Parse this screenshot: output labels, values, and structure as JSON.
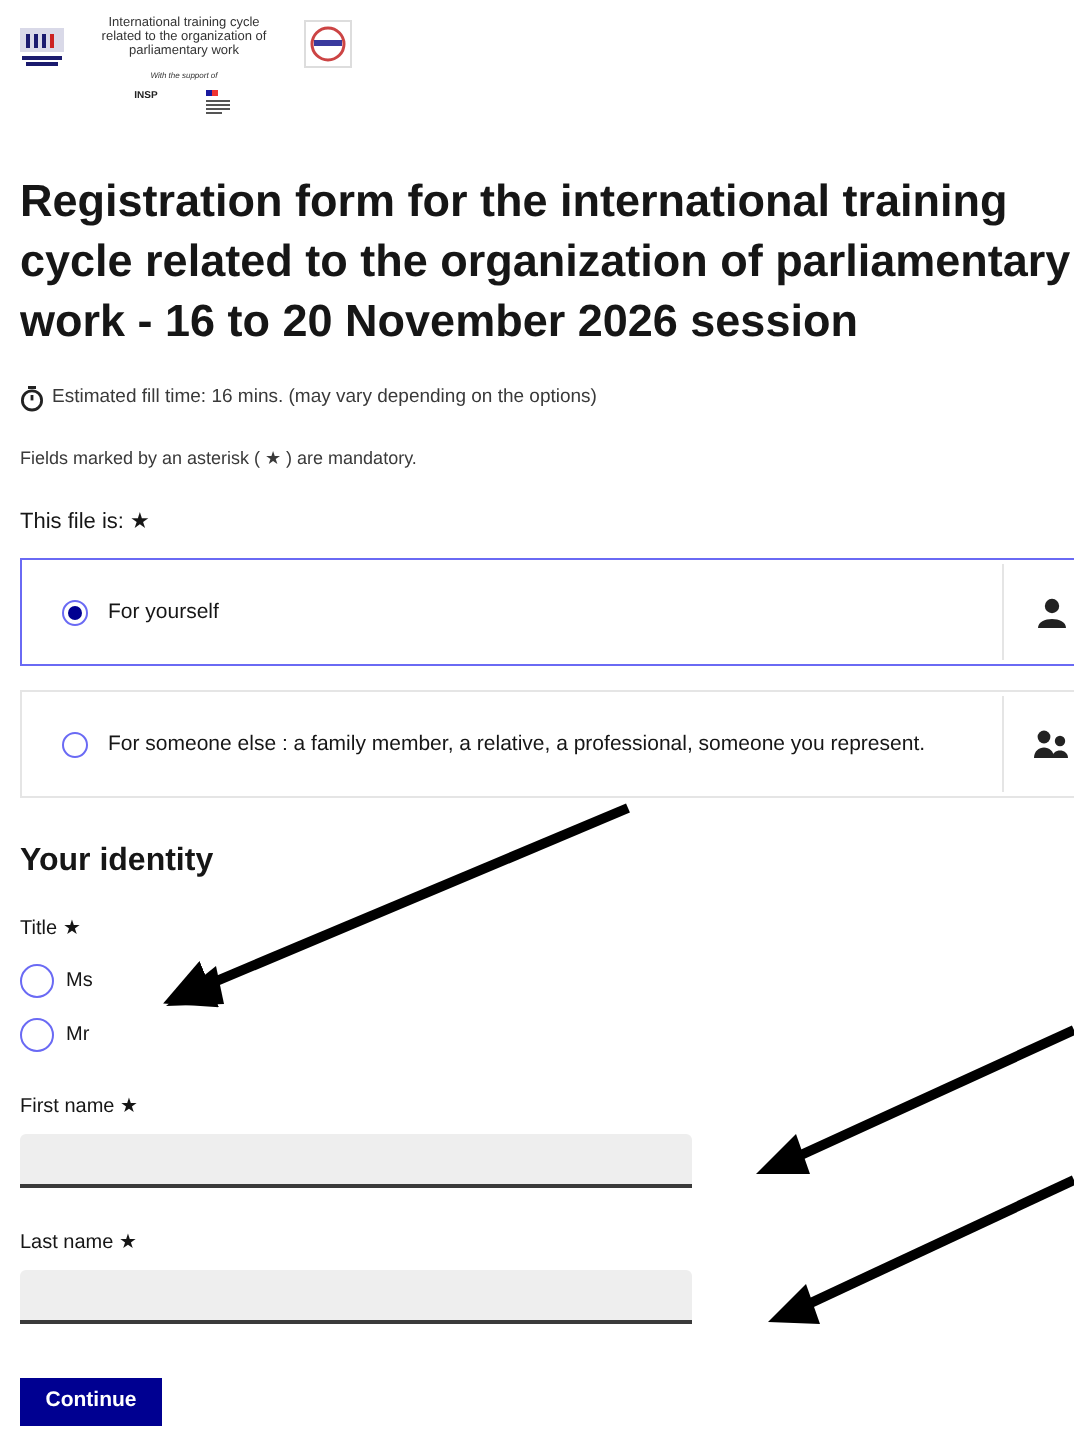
{
  "header": {
    "program_title": "International training cycle related to the organization of parliamentary work",
    "support_text": "With the support of",
    "partner_logo_text": "INSP"
  },
  "title": "Registration form for the international training cycle related to the organization of parliamentary work - 16 to 20 November 2026 session",
  "fill_time": "Estimated fill time: 16 mins. (may vary depending on the options)",
  "mandatory_note": "Fields marked by an asterisk ( ★ ) are mandatory.",
  "file_for": {
    "label": "This file is: ★",
    "options": [
      {
        "label": "For yourself",
        "selected": true,
        "kind": "single"
      },
      {
        "label": "For someone else : a family member, a relative, a professional, someone you represent.",
        "selected": false,
        "kind": "group"
      }
    ]
  },
  "identity": {
    "heading": "Your identity",
    "title_field": {
      "label": "Title ★",
      "options": [
        {
          "label": "Ms",
          "selected": false
        },
        {
          "label": "Mr",
          "selected": false
        }
      ]
    },
    "fields": [
      {
        "label": "First name ★"
      },
      {
        "label": "Last name ★"
      }
    ]
  },
  "continue_button": "Continue"
}
